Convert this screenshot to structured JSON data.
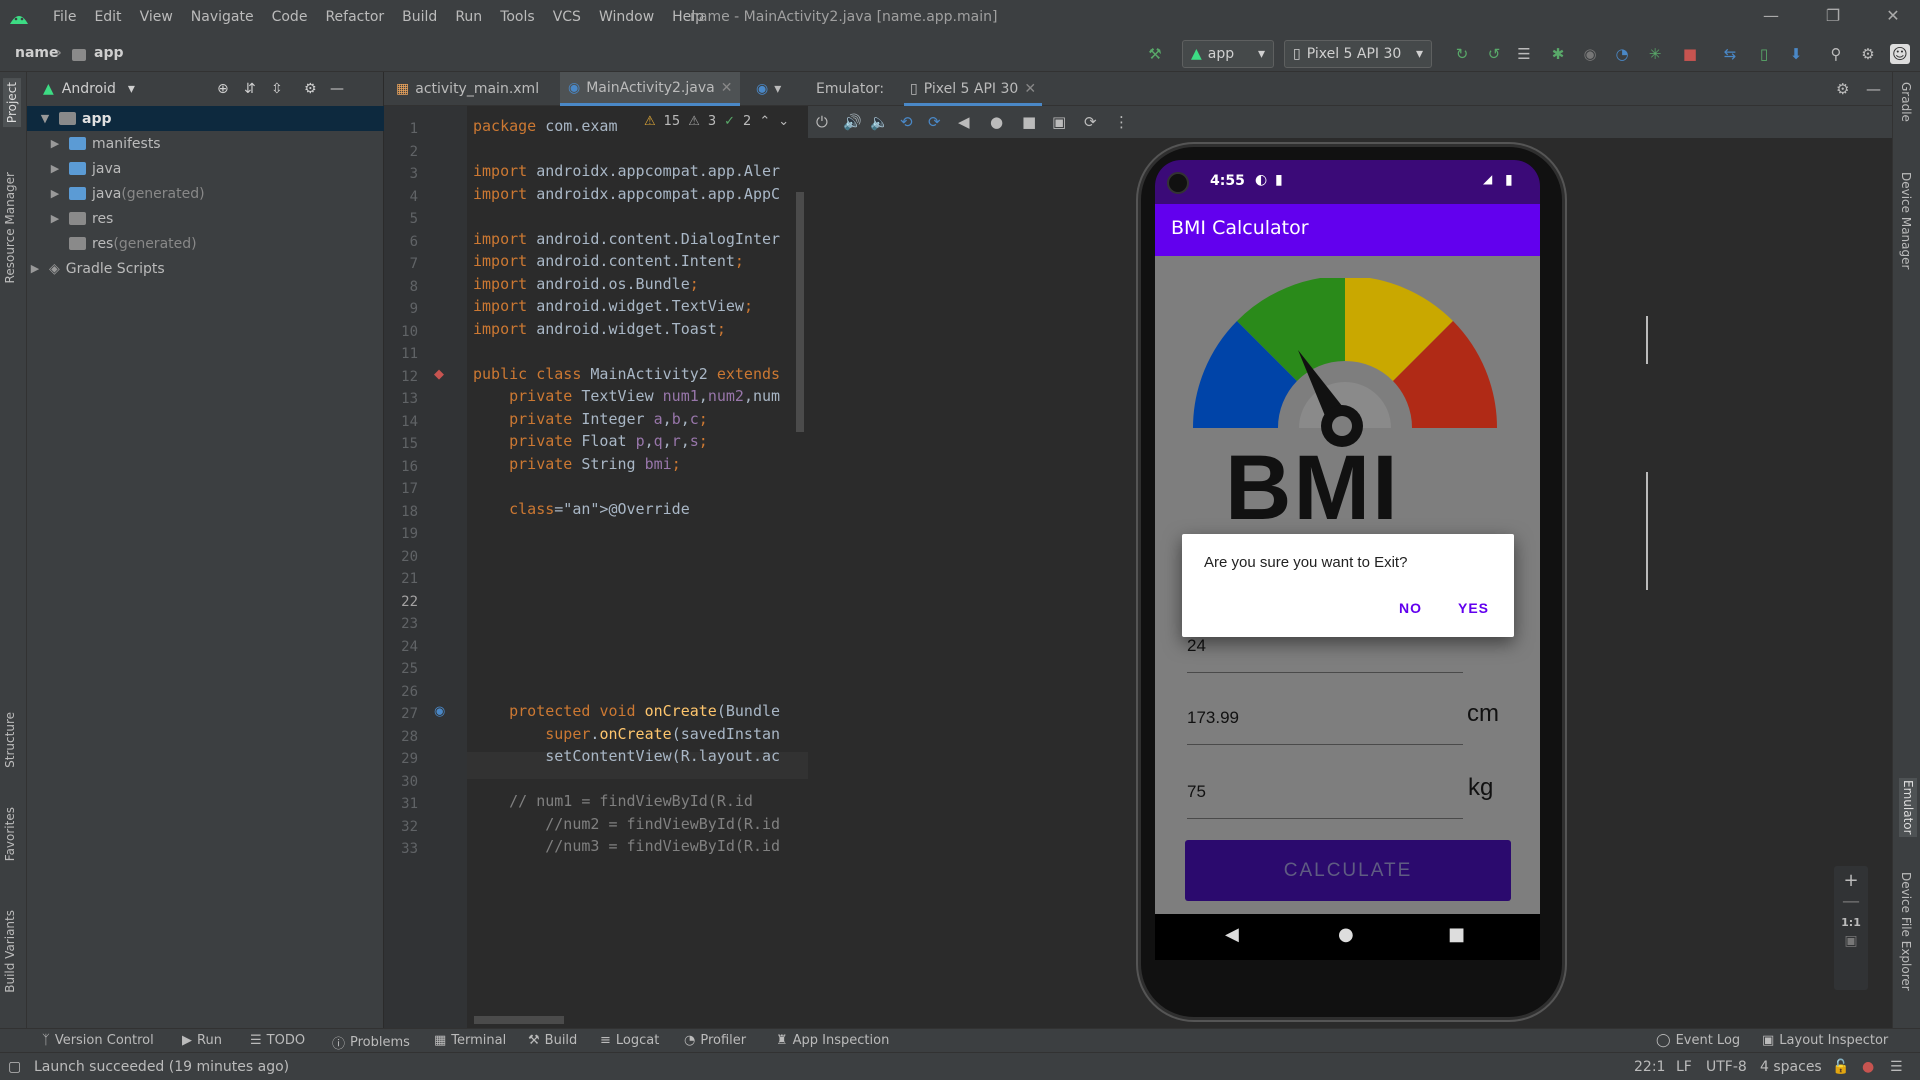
{
  "menu": [
    "File",
    "Edit",
    "View",
    "Navigate",
    "Code",
    "Refactor",
    "Build",
    "Run",
    "Tools",
    "VCS",
    "Window",
    "Help"
  ],
  "window_title": "name - MainActivity2.java [name.app.main]",
  "breadcrumb": {
    "project": "name",
    "module": "app"
  },
  "toolbar": {
    "run_config": "app",
    "device": "Pixel 5 API 30"
  },
  "project_panel": {
    "view": "Android",
    "items": [
      {
        "label": "app",
        "suffix": ""
      },
      {
        "label": "manifests",
        "suffix": ""
      },
      {
        "label": "java",
        "suffix": ""
      },
      {
        "label": "java",
        "suffix": " (generated)"
      },
      {
        "label": "res",
        "suffix": ""
      },
      {
        "label": "res",
        "suffix": " (generated)"
      },
      {
        "label": "Gradle Scripts",
        "suffix": ""
      }
    ]
  },
  "left_stripe": {
    "project": "Project",
    "resource_manager": "Resource Manager",
    "structure": "Structure",
    "favorites": "Favorites",
    "build_variants": "Build Variants"
  },
  "right_stripe": {
    "gradle": "Gradle",
    "device_manager": "Device Manager",
    "emulator": "Emulator",
    "device_file_explorer": "Device File Explorer"
  },
  "editor": {
    "tabs": [
      "activity_main.xml",
      "MainActivity2.java"
    ],
    "inspections": {
      "warnings": "15",
      "weak_warnings": "3",
      "typos": "2"
    },
    "current_line": 22,
    "lines": [
      "package com.exam",
      "",
      "import androidx.appcompat.app.Aler",
      "import androidx.appcompat.app.AppC",
      "",
      "import android.content.DialogInter",
      "import android.content.Intent;",
      "import android.os.Bundle;",
      "import android.widget.TextView;",
      "import android.widget.Toast;",
      "",
      "public class MainActivity2 extends",
      "    private TextView num1,num2,num",
      "    private Integer a,b,c;",
      "    private Float p,q,r,s;",
      "    private String bmi;",
      "",
      "    @Override",
      "",
      "",
      "",
      "",
      "",
      "",
      "",
      "",
      "    protected void onCreate(Bundle",
      "        super.onCreate(savedInstan",
      "        setContentView(R.layout.ac",
      "",
      "    // num1 = findViewById(R.id",
      "        //num2 = findViewById(R.id",
      "        //num3 = findViewById(R.id"
    ]
  },
  "emulator": {
    "label": "Emulator:",
    "tab": "Pixel 5 API 30",
    "zoom_label": "1:1",
    "phone": {
      "time": "4:55",
      "app_title": "BMI Calculator",
      "logo_text": "BMI",
      "dialog": {
        "message": "Are you sure you want to Exit?",
        "no": "NO",
        "yes": "YES"
      },
      "age": "24",
      "height": "173.99",
      "height_unit": "cm",
      "weight": "75",
      "weight_unit": "kg",
      "calculate": "CALCULATE"
    }
  },
  "tool_windows": [
    "Version Control",
    "Run",
    "TODO",
    "Problems",
    "Terminal",
    "Build",
    "Logcat",
    "Profiler",
    "App Inspection"
  ],
  "tool_windows_right": [
    "Event Log",
    "Layout Inspector"
  ],
  "status": {
    "message": "Launch succeeded (19 minutes ago)",
    "position": "22:1",
    "line_sep": "LF",
    "encoding": "UTF-8",
    "indent": "4 spaces"
  },
  "colors": {
    "accent": "#6200ee",
    "status_bar": "#3b0a78",
    "ide_bg": "#2b2b2b",
    "panel_bg": "#3c3f41",
    "tab_underline": "#4a88c7"
  }
}
